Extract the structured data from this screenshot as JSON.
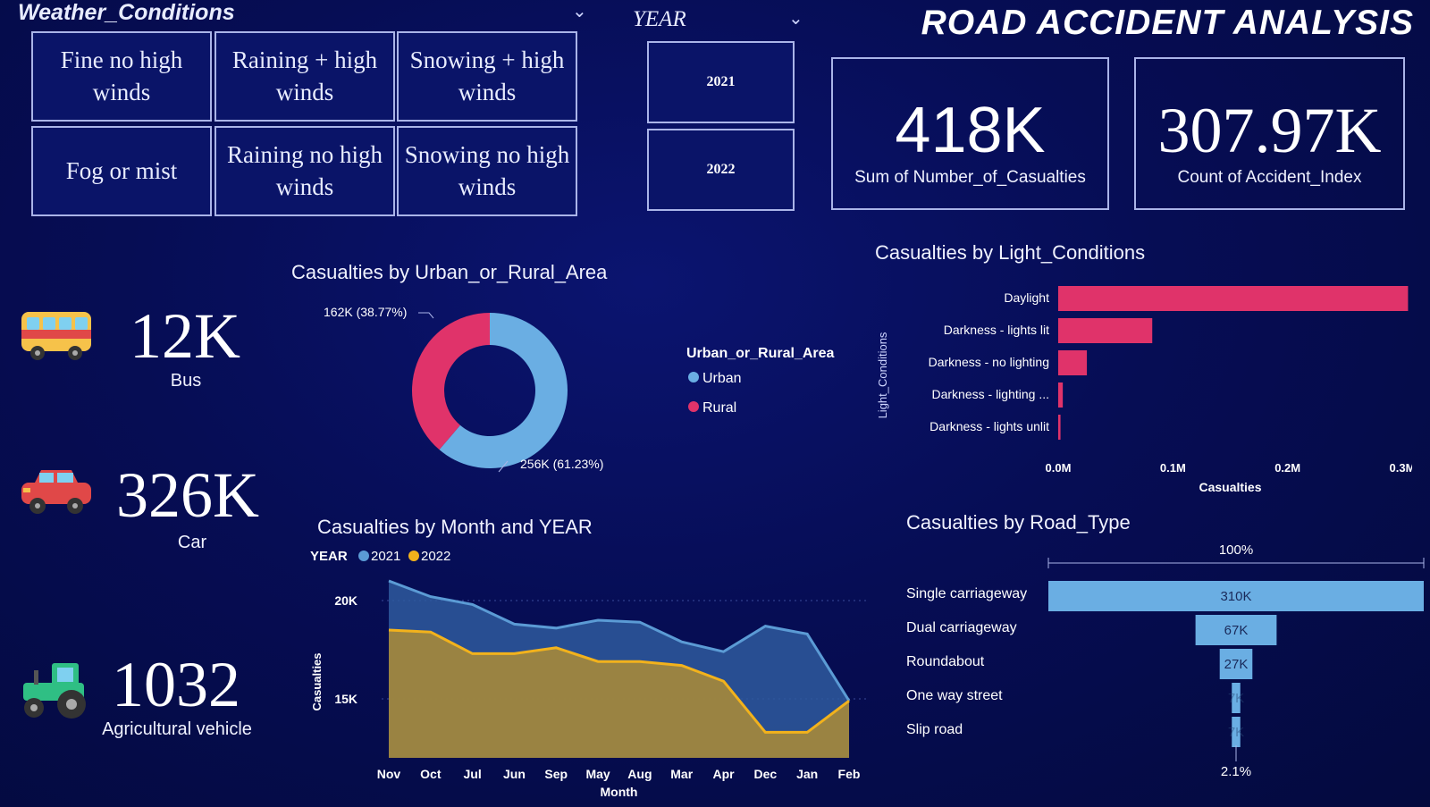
{
  "weather": {
    "title": "Weather_Conditions",
    "options": [
      "Fine no high winds",
      "Raining + high winds",
      "Snowing + high winds",
      "Fog or mist",
      "Raining no high winds",
      "Snowing no high winds"
    ]
  },
  "year_slicer": {
    "title": "YEAR",
    "options": [
      "2021",
      "2022"
    ]
  },
  "header": {
    "title": "ROAD ACCIDENT ANALYSIS"
  },
  "kpis": [
    {
      "value": "418K",
      "label": "Sum of Number_of_Casualties"
    },
    {
      "value": "307.97K",
      "label": "Count of Accident_Index"
    }
  ],
  "vehicles": [
    {
      "value": "12K",
      "label": "Bus",
      "icon": "bus-icon"
    },
    {
      "value": "326K",
      "label": "Car",
      "icon": "car-icon"
    },
    {
      "value": "1032",
      "label": "Agricultural vehicle",
      "icon": "tractor-icon"
    }
  ],
  "colors": {
    "urban": "#6aaee3",
    "rural": "#e0336a",
    "y2021": "#5b9bd5",
    "y2022": "#f2b21c",
    "bar": "#e0336a",
    "funnel": "#6aaee3"
  },
  "chart_data": [
    {
      "type": "pie",
      "title": "Casualties by Urban_or_Rural_Area",
      "legend_title": "Urban_or_Rural_Area",
      "labels": [
        "Urban",
        "Rural"
      ],
      "values": [
        256,
        162
      ],
      "data_labels": [
        "256K (61.23%)",
        "162K (38.77%)"
      ]
    },
    {
      "type": "bar",
      "title": "Casualties by Light_Conditions",
      "ylabel": "Light_Conditions",
      "xlabel": "Casualties",
      "categories": [
        "Daylight",
        "Darkness - lights lit",
        "Darkness - no lighting",
        "Darkness - lighting ...",
        "Darkness - lights unlit"
      ],
      "values": [
        305000,
        82000,
        25000,
        4000,
        2000
      ],
      "xticks": [
        "0.0M",
        "0.1M",
        "0.2M",
        "0.3M"
      ],
      "xlim": [
        0,
        300000
      ]
    },
    {
      "type": "area",
      "title": "Casualties by Month and YEAR",
      "legend_title": "YEAR",
      "xlabel": "Month",
      "ylabel": "Casualties",
      "categories": [
        "Nov",
        "Oct",
        "Jul",
        "Jun",
        "Sep",
        "May",
        "Aug",
        "Mar",
        "Apr",
        "Dec",
        "Jan",
        "Feb"
      ],
      "series": [
        {
          "name": "2021",
          "values": [
            21000,
            20200,
            19800,
            18800,
            18600,
            19000,
            18900,
            17900,
            17400,
            18700,
            18300,
            14900
          ]
        },
        {
          "name": "2022",
          "values": [
            18500,
            18400,
            17300,
            17300,
            17600,
            16900,
            16900,
            16700,
            15900,
            13300,
            13300,
            14900
          ]
        }
      ],
      "yticks": [
        "15K",
        "20K"
      ],
      "ylim": [
        12000,
        22000
      ]
    },
    {
      "type": "bar",
      "title": "Casualties by Road_Type",
      "categories": [
        "Single carriageway",
        "Dual carriageway",
        "Roundabout",
        "One way street",
        "Slip road"
      ],
      "values": [
        310000,
        67000,
        27000,
        7000,
        7000
      ],
      "data_labels": [
        "310K",
        "67K",
        "27K",
        "7K",
        "7K"
      ],
      "top_label": "100%",
      "bottom_label": "2.1%"
    }
  ]
}
